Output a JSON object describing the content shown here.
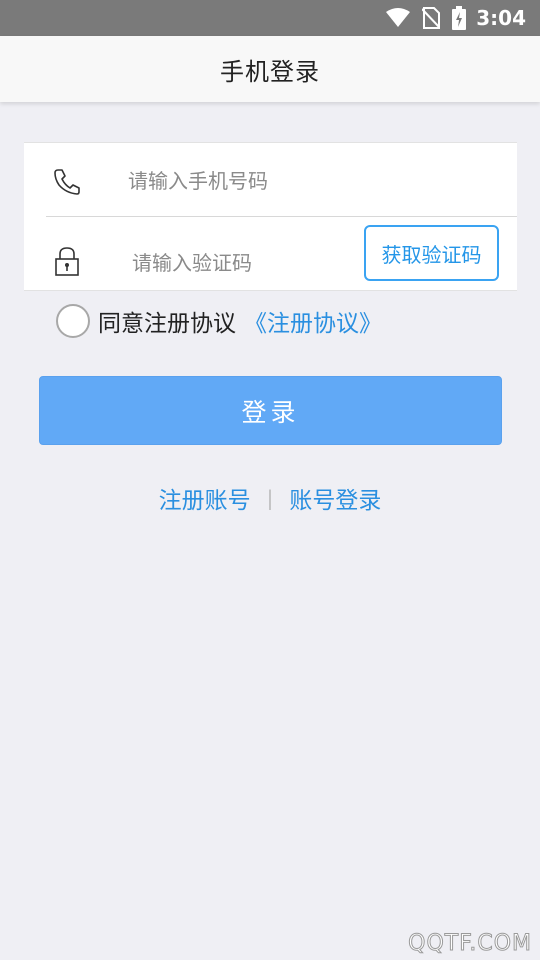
{
  "status_bar": {
    "time": "3:04",
    "icons": [
      "wifi-icon",
      "no-sim-icon",
      "battery-charging-icon"
    ]
  },
  "header": {
    "title": "手机登录"
  },
  "form": {
    "phone": {
      "icon": "phone-icon",
      "placeholder": "请输入手机号码",
      "value": ""
    },
    "code": {
      "icon": "lock-icon",
      "placeholder": "请输入验证码",
      "value": "",
      "get_code_label": "获取验证码"
    }
  },
  "agreement": {
    "checked": false,
    "label": "同意注册协议",
    "link": "《注册协议》"
  },
  "login_button": {
    "label": "登录"
  },
  "links": {
    "register": "注册账号",
    "separator": "|",
    "account_login": "账号登录"
  },
  "watermark": "QQTF.COM",
  "colors": {
    "accent": "#2a8fe0",
    "login_button": "#61a9f6",
    "background": "#efeff4",
    "status_bar": "#7a7a7a"
  }
}
